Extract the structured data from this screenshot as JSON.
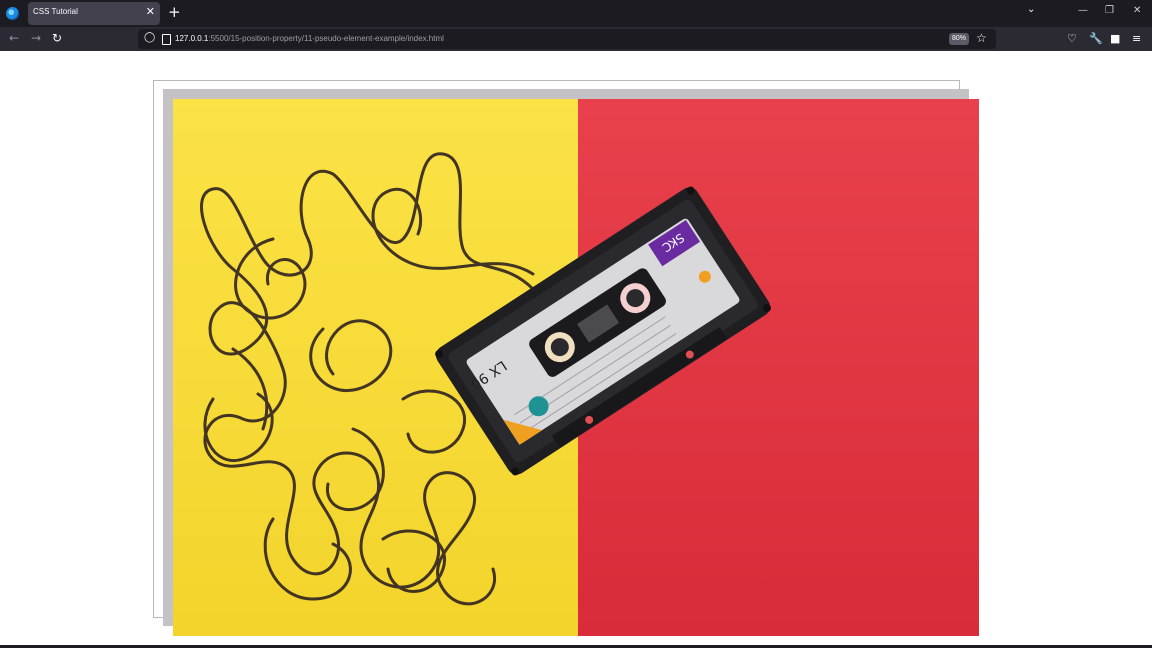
{
  "browser": {
    "tab_title": "CSS Tutorial",
    "tab_close_glyph": "✕",
    "new_tab_glyph": "+",
    "url_host": "127.0.0.1",
    "url_path": ":5500/15-position-property/11-pseudo-element-example/index.html",
    "zoom_level": "80%",
    "icons": [
      "firefox-logo",
      "back-arrow",
      "forward-arrow",
      "reload",
      "shield",
      "page",
      "bookmark-star",
      "pocket",
      "wrench",
      "extensions",
      "hamburger-menu",
      "tab-list-chevron",
      "minimize",
      "restore",
      "close"
    ]
  },
  "page": {
    "image_subject": "cassette tape with unspooled tape on yellow and red background",
    "colors": {
      "yellow": "#f9dd3c",
      "red": "#e0323f",
      "shadow": "#c4c2c5"
    }
  }
}
